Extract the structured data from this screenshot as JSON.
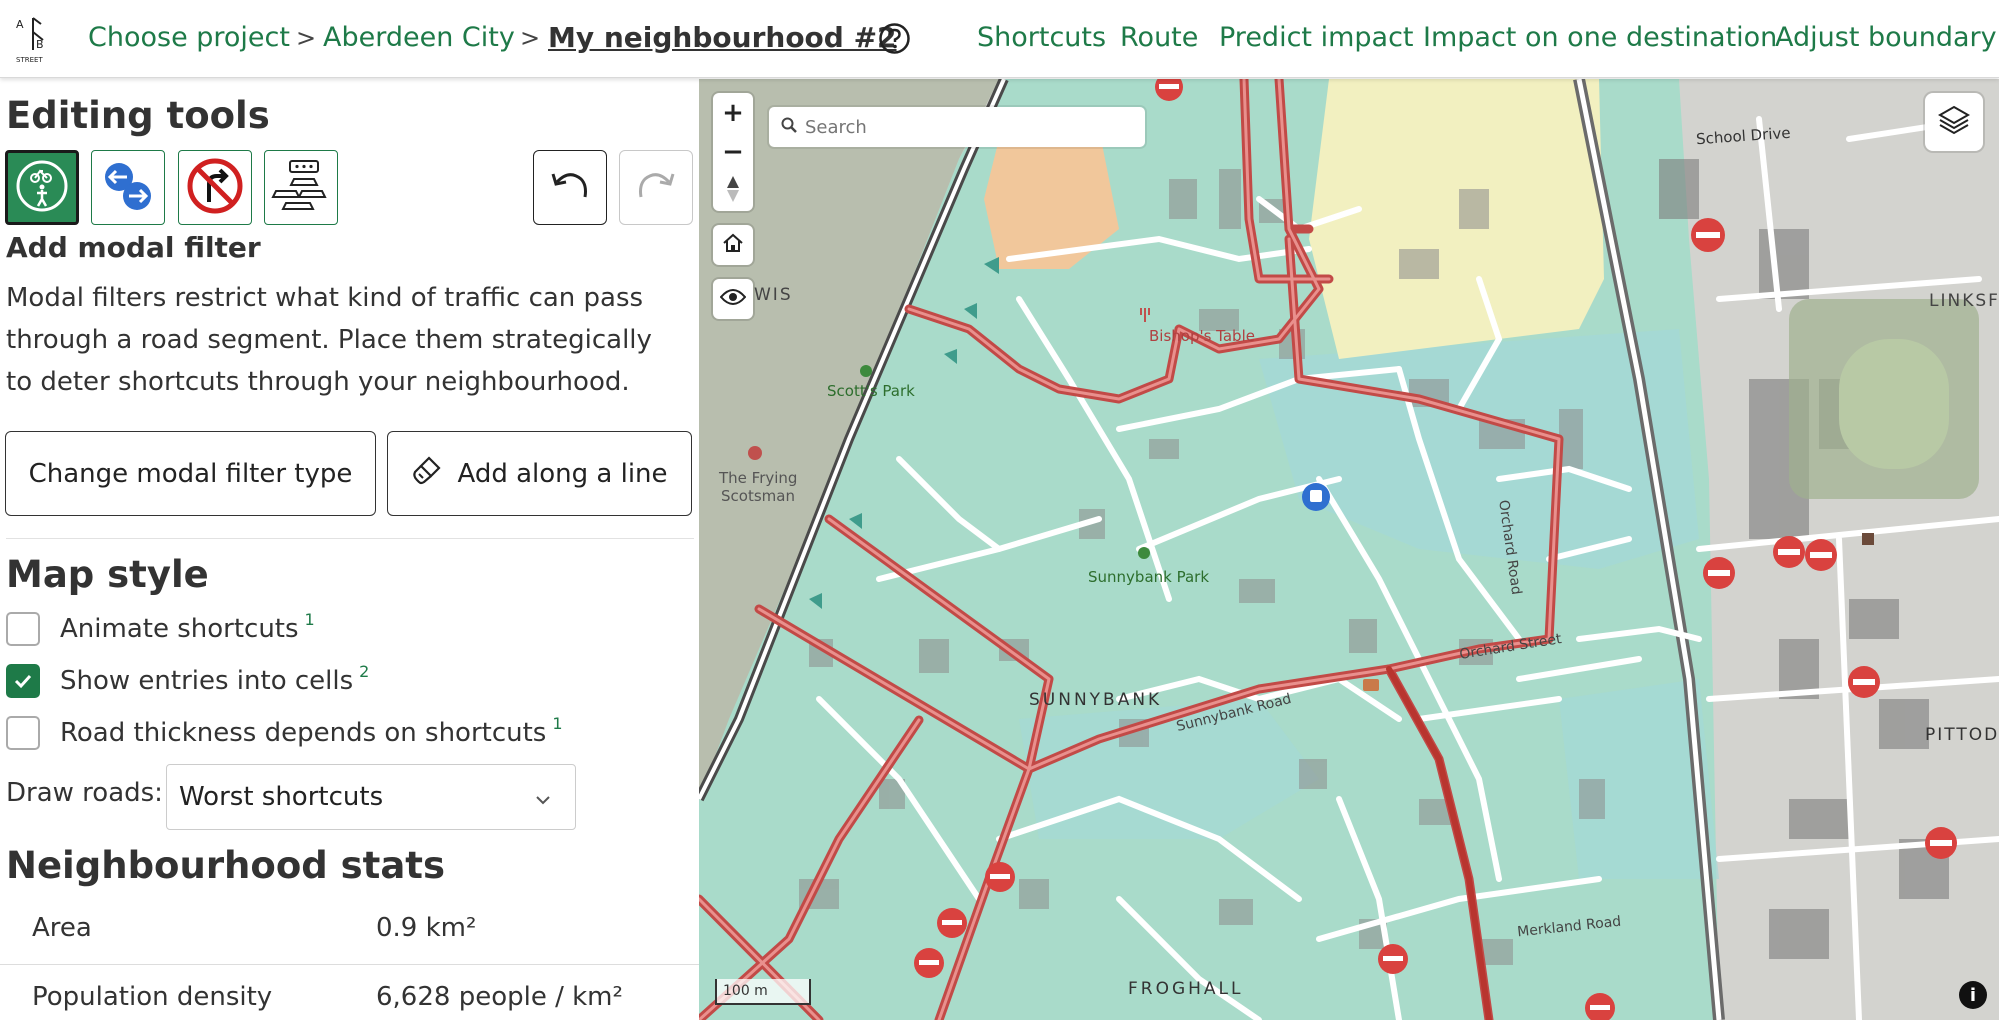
{
  "nav": {
    "breadcrumb": [
      "Choose project",
      "Aberdeen City"
    ],
    "separator": ">",
    "current": "My neighbourhood #2",
    "links": [
      "Shortcuts",
      "Route",
      "Predict impact",
      "Impact on one destination",
      "Adjust boundary"
    ],
    "logo_text": "STREET"
  },
  "colors": {
    "accent": "#1e7a48",
    "active_tool": "#2a8b56",
    "shortcut_road": "#d9534f",
    "cell_fill": "#a8dcc8",
    "filter_red": "#d9423f"
  },
  "sidebar": {
    "editing_title": "Editing tools",
    "tools": [
      {
        "icon": "modal-filter-icon",
        "active": true
      },
      {
        "icon": "one-way-icon",
        "active": false
      },
      {
        "icon": "turn-restriction-icon",
        "active": false
      },
      {
        "icon": "main-road-icon",
        "active": false
      }
    ],
    "undo_icon": "undo-icon",
    "redo_icon": "redo-icon",
    "tool_title": "Add modal filter",
    "tool_desc": "Modal filters restrict what kind of traffic can pass through a road segment. Place them strategically to deter shortcuts through your neighbourhood.",
    "change_type_label": "Change modal filter type",
    "add_line_label": "Add along a line",
    "map_style_title": "Map style",
    "options": [
      {
        "label": "Animate shortcuts",
        "sup": "1",
        "checked": false
      },
      {
        "label": "Show entries into cells",
        "sup": "2",
        "checked": true
      },
      {
        "label": "Road thickness depends on shortcuts",
        "sup": "1",
        "checked": false
      }
    ],
    "draw_roads_label": "Draw roads:",
    "draw_roads_value": "Worst shortcuts",
    "stats_title": "Neighbourhood stats",
    "stats": [
      {
        "key": "Area",
        "value": "0.9 km²"
      },
      {
        "key": "Population density",
        "value": "6,628 people / km²"
      }
    ]
  },
  "map": {
    "search_placeholder": "Search",
    "zoom_in": "+",
    "zoom_out": "−",
    "scale": "100 m",
    "info": "i",
    "labels": {
      "school_drive": "School Drive",
      "linksfield": "LINKSFIEL",
      "wis": "WIS",
      "bishops_table": "Bishop's Table",
      "scotts_park": "Scott's Park",
      "frying_scotsman_1": "The Frying",
      "frying_scotsman_2": "Scotsman",
      "sunnybank_park": "Sunnybank Park",
      "orchard_road": "Orchard Road",
      "orchard_street": "Orchard Street",
      "sunnybank": "SUNNYBANK",
      "sunnybank_road": "Sunnybank Road",
      "pittodrie": "PITTODRI",
      "merkland_road": "Merkland Road",
      "froghall": "FROGHALL"
    }
  }
}
